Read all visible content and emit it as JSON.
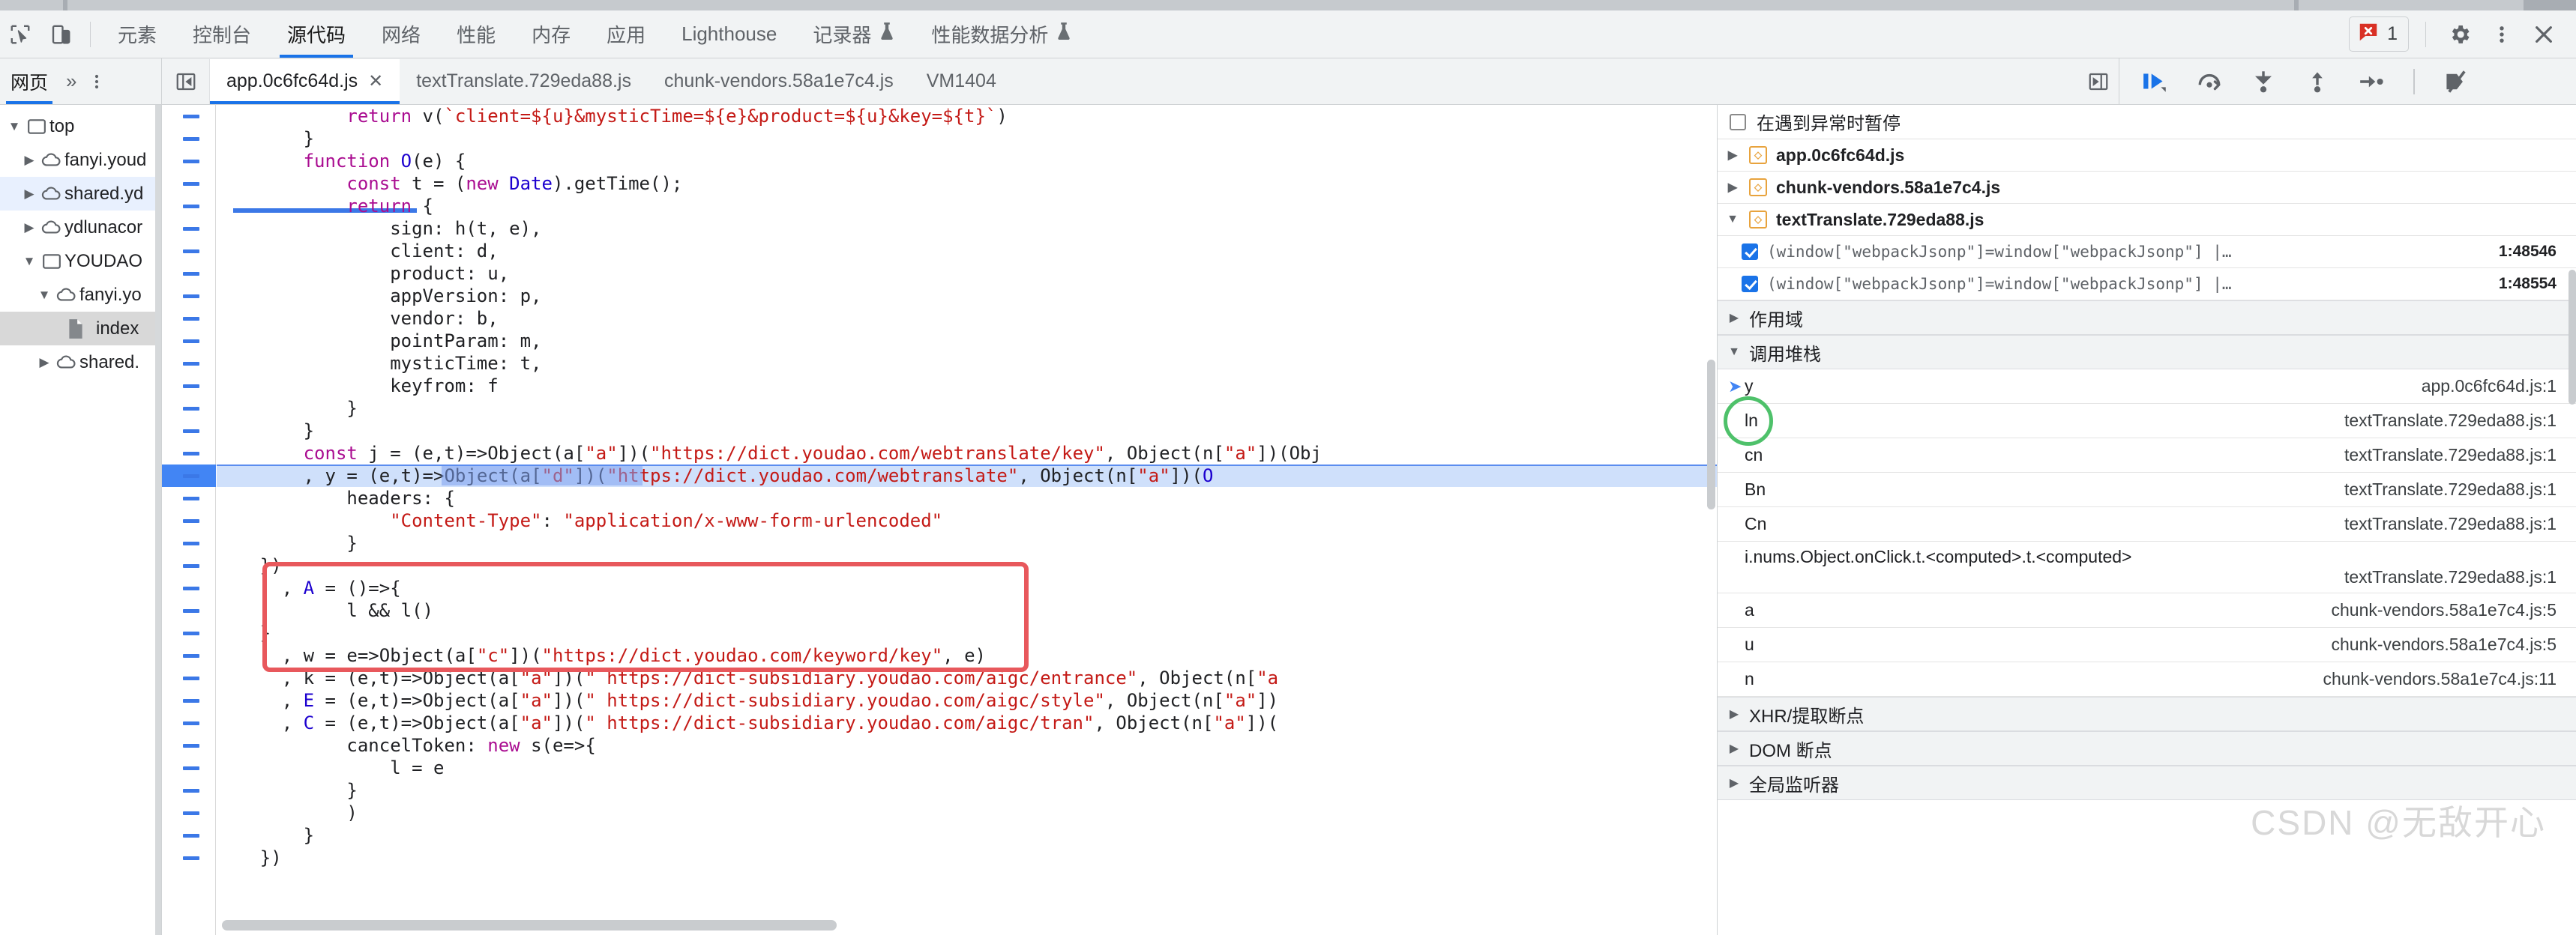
{
  "devtools": {
    "tabs": [
      {
        "label": "元素",
        "active": false
      },
      {
        "label": "控制台",
        "active": false
      },
      {
        "label": "源代码",
        "active": true
      },
      {
        "label": "网络",
        "active": false
      },
      {
        "label": "性能",
        "active": false
      },
      {
        "label": "内存",
        "active": false
      },
      {
        "label": "应用",
        "active": false
      },
      {
        "label": "Lighthouse",
        "active": false
      },
      {
        "label": "记录器",
        "active": false,
        "beaker": true
      },
      {
        "label": "性能数据分析",
        "active": false,
        "beaker": true
      }
    ],
    "error_count": "1",
    "icons": {
      "inspect": "inspect-element-icon",
      "device": "device-toolbar-icon",
      "error_badge": "error-badge-icon",
      "settings": "gear-icon",
      "more": "kebab-menu-icon",
      "close": "close-icon"
    }
  },
  "navigator": {
    "tabs": [
      {
        "label": "网页",
        "active": true
      }
    ],
    "overflow": "»",
    "more": "⋮"
  },
  "editor_tabs": [
    {
      "label": "app.0c6fc64d.js",
      "active": true,
      "closable": true
    },
    {
      "label": "textTranslate.729eda88.js",
      "active": false,
      "closable": false
    },
    {
      "label": "chunk-vendors.58a1e7c4.js",
      "active": false,
      "closable": false
    },
    {
      "label": "VM1404",
      "active": false,
      "closable": false
    }
  ],
  "debug_toolbar": [
    {
      "name": "resume-script-execution",
      "icon": "resume-icon"
    },
    {
      "name": "step-over",
      "icon": "step-over-icon"
    },
    {
      "name": "step-into",
      "icon": "step-into-icon"
    },
    {
      "name": "step-out",
      "icon": "step-out-icon"
    },
    {
      "name": "step",
      "icon": "step-icon"
    },
    {
      "name": "deactivate-breakpoints",
      "icon": "deactivate-breakpoints-icon"
    }
  ],
  "file_tree": [
    {
      "label": "top",
      "depth": 0,
      "arrow": "▼",
      "icon": "frame-icon",
      "state": "none"
    },
    {
      "label": "fanyi.youd",
      "depth": 1,
      "arrow": "▶",
      "icon": "cloud-icon",
      "state": "none"
    },
    {
      "label": "shared.yd",
      "depth": 1,
      "arrow": "▶",
      "icon": "cloud-icon",
      "state": "sel-light"
    },
    {
      "label": "ydlunacor",
      "depth": 1,
      "arrow": "▶",
      "icon": "cloud-icon",
      "state": "none"
    },
    {
      "label": "YOUDAO",
      "depth": 1,
      "arrow": "▼",
      "icon": "frame-icon",
      "state": "none"
    },
    {
      "label": "fanyi.yo",
      "depth": 2,
      "arrow": "▼",
      "icon": "cloud-icon",
      "state": "none"
    },
    {
      "label": "index",
      "depth": 3,
      "arrow": "",
      "icon": "file-icon",
      "state": "sel-grey"
    },
    {
      "label": "shared.",
      "depth": 2,
      "arrow": "▶",
      "icon": "cloud-icon",
      "state": "none"
    }
  ],
  "code_lines": [
    {
      "indent": 0,
      "raw": "            return v(`client=${u}&mysticTime=${e}&product=${u}&key=${t}`)",
      "truncated_top": true
    },
    {
      "indent": 0,
      "raw": "        }"
    },
    {
      "indent": 0,
      "raw": "        function O(e) {"
    },
    {
      "indent": 0,
      "raw": "            const t = (new Date).getTime();"
    },
    {
      "indent": 0,
      "raw": "            return {"
    },
    {
      "indent": 0,
      "raw": "                sign: h(t, e),"
    },
    {
      "indent": 0,
      "raw": "                client: d,"
    },
    {
      "indent": 0,
      "raw": "                product: u,"
    },
    {
      "indent": 0,
      "raw": "                appVersion: p,"
    },
    {
      "indent": 0,
      "raw": "                vendor: b,"
    },
    {
      "indent": 0,
      "raw": "                pointParam: m,"
    },
    {
      "indent": 0,
      "raw": "                mysticTime: t,"
    },
    {
      "indent": 0,
      "raw": "                keyfrom: f"
    },
    {
      "indent": 0,
      "raw": "            }"
    },
    {
      "indent": 0,
      "raw": "        }"
    },
    {
      "indent": 0,
      "raw": "        const j = (e,t)=>Object(a[\"a\"])(\"https://dict.youdao.com/webtranslate/key\", Object(n[\"a\"])(Obj"
    },
    {
      "indent": 0,
      "raw": "        , y = (e,t)=>Object(a[\"d\"])(\"https://dict.youdao.com/webtranslate\", Object(n[\"a\"])(O",
      "highlight": true
    },
    {
      "indent": 0,
      "raw": "            headers: {"
    },
    {
      "indent": 0,
      "raw": "                \"Content-Type\": \"application/x-www-form-urlencoded\""
    },
    {
      "indent": 0,
      "raw": "            }"
    },
    {
      "indent": 0,
      "raw": "    })"
    },
    {
      "indent": 0,
      "raw": "      , A = ()=>{"
    },
    {
      "indent": 0,
      "raw": "            l && l()"
    },
    {
      "indent": 0,
      "raw": "    }"
    },
    {
      "indent": 0,
      "raw": "      , w = e=>Object(a[\"c\"])(\"https://dict.youdao.com/keyword/key\", e)"
    },
    {
      "indent": 0,
      "raw": "      , k = (e,t)=>Object(a[\"a\"])(\" https://dict-subsidiary.youdao.com/aigc/entrance\", Object(n[\"a"
    },
    {
      "indent": 0,
      "raw": "      , E = (e,t)=>Object(a[\"a\"])(\" https://dict-subsidiary.youdao.com/aigc/style\", Object(n[\"a\"])"
    },
    {
      "indent": 0,
      "raw": "      , C = (e,t)=>Object(a[\"a\"])(\" https://dict-subsidiary.youdao.com/aigc/tran\", Object(n[\"a\"])("
    },
    {
      "indent": 0,
      "raw": "            cancelToken: new s(e=>{"
    },
    {
      "indent": 0,
      "raw": "                l = e"
    },
    {
      "indent": 0,
      "raw": "            }"
    },
    {
      "indent": 0,
      "raw": "            )"
    },
    {
      "indent": 0,
      "raw": "        }"
    },
    {
      "indent": 0,
      "raw": "    })"
    }
  ],
  "sidebar": {
    "pause_on_exceptions": {
      "label": "在遇到异常时暂停",
      "checked": false
    },
    "breakpoint_files": [
      {
        "name": "app.0c6fc64d.js",
        "arrow": "▶",
        "expanded": false,
        "entries": []
      },
      {
        "name": "chunk-vendors.58a1e7c4.js",
        "arrow": "▶",
        "expanded": false,
        "entries": []
      },
      {
        "name": "textTranslate.729eda88.js",
        "arrow": "▼",
        "expanded": true,
        "entries": [
          {
            "text": "(window[\"webpackJsonp\"]=window[\"webpackJsonp\"] |…",
            "location": "1:48546",
            "checked": true
          },
          {
            "text": "(window[\"webpackJsonp\"]=window[\"webpackJsonp\"] |…",
            "location": "1:48554",
            "checked": true
          }
        ]
      }
    ],
    "sections": [
      {
        "label": "作用域",
        "arrow": "▶",
        "expanded": false
      },
      {
        "label": "调用堆栈",
        "arrow": "▼",
        "expanded": true
      }
    ],
    "call_stack": [
      {
        "fn": "y",
        "loc": "app.0c6fc64d.js:1",
        "current": true,
        "wrap": false
      },
      {
        "fn": "ln",
        "loc": "textTranslate.729eda88.js:1",
        "current": false,
        "wrap": false,
        "circled": true
      },
      {
        "fn": "cn",
        "loc": "textTranslate.729eda88.js:1",
        "current": false,
        "wrap": false
      },
      {
        "fn": "Bn",
        "loc": "textTranslate.729eda88.js:1",
        "current": false,
        "wrap": false
      },
      {
        "fn": "Cn",
        "loc": "textTranslate.729eda88.js:1",
        "current": false,
        "wrap": false
      },
      {
        "fn": "i.nums.Object.onClick.t.<computed>.t.<computed>",
        "loc": "textTranslate.729eda88.js:1",
        "current": false,
        "wrap": true
      },
      {
        "fn": "a",
        "loc": "chunk-vendors.58a1e7c4.js:5",
        "current": false,
        "wrap": false
      },
      {
        "fn": "u",
        "loc": "chunk-vendors.58a1e7c4.js:5",
        "current": false,
        "wrap": false
      },
      {
        "fn": "n",
        "loc": "chunk-vendors.58a1e7c4.js:11",
        "current": false,
        "wrap": false
      }
    ],
    "bottom_sections": [
      {
        "label": "XHR/提取断点",
        "arrow": "▶"
      },
      {
        "label": "DOM 断点",
        "arrow": "▶"
      },
      {
        "label": "全局监听器",
        "arrow": "▶"
      }
    ]
  },
  "watermark": "CSDN @无敌开心",
  "colors": {
    "accent": "#1a73e8",
    "toolbar_bg": "#f1f3f4",
    "highlight_line": "#cfe0fb",
    "annotation_red": "#e8585c",
    "annotation_green": "#4ec16a",
    "error_red": "#d93025"
  }
}
